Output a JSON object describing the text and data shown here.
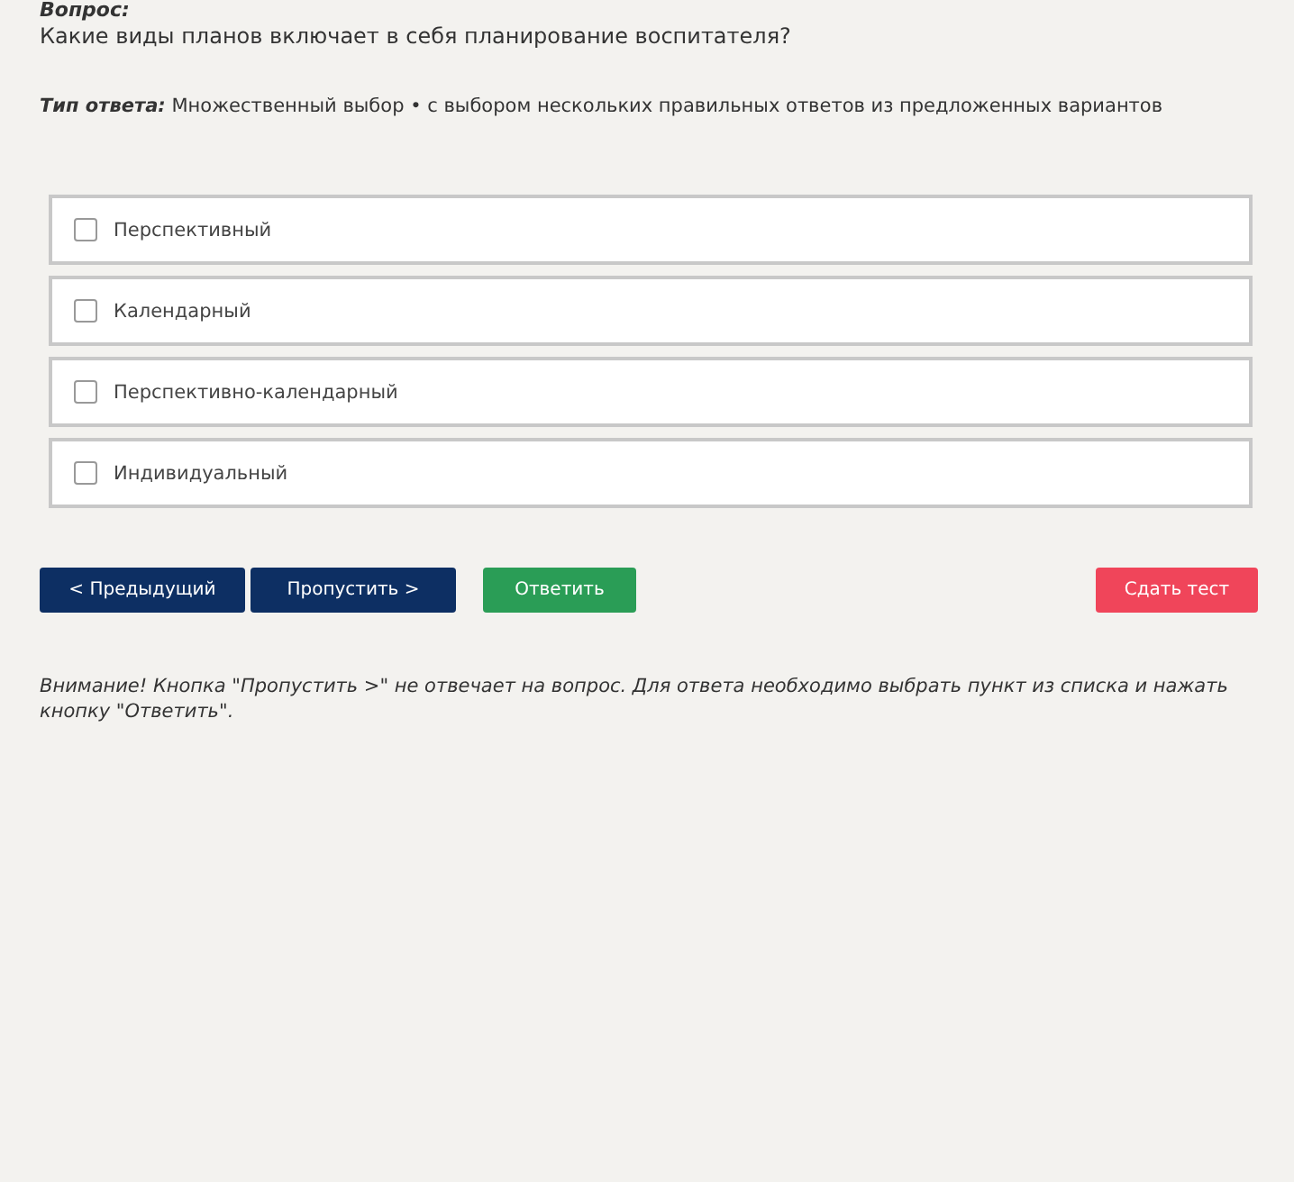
{
  "question_label": "Вопрос:",
  "question": "Какие виды планов включает в себя планирование воспитателя?",
  "answer_type": {
    "label": "Тип ответа:",
    "value": "Множественный выбор • с выбором нескольких правильных ответов из предложенных вариантов"
  },
  "options": [
    {
      "label": "Перспективный",
      "checked": false
    },
    {
      "label": "Календарный",
      "checked": false
    },
    {
      "label": "Перспективно-календарный",
      "checked": false
    },
    {
      "label": "Индивидуальный",
      "checked": false
    }
  ],
  "buttons": [
    {
      "label": "< Предыдущий",
      "kind": "nav"
    },
    {
      "label": "Пропустить >",
      "kind": "nav"
    },
    {
      "label": "Ответить",
      "kind": "answer"
    },
    {
      "label": "Сдать тест",
      "kind": "submit"
    }
  ],
  "note": "Внимание! Кнопка \"Пропустить >\" не отвечает на вопрос. Для ответа необходимо выбрать пункт из списка и нажать кнопку \"Ответить\"."
}
